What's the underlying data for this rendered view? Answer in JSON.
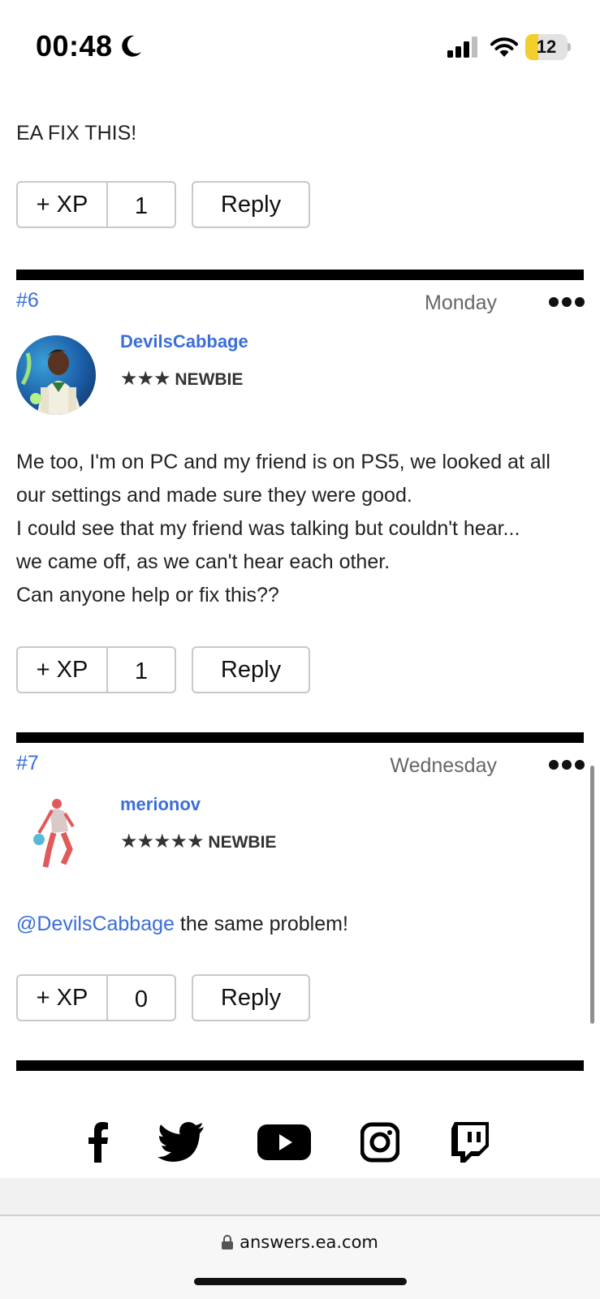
{
  "status_bar": {
    "time": "00:48",
    "battery": "12",
    "battery_level": 0.12
  },
  "posts": [
    {
      "text": "EA FIX THIS!",
      "xp_label": "+ XP",
      "xp_count": "1",
      "reply_label": "Reply"
    },
    {
      "number": "#6",
      "date": "Monday",
      "username": "DevilsCabbage",
      "stars": "★★★",
      "rank": "NEWBIE",
      "lines": [
        "Me too, I'm on PC and my friend is on PS5, we looked at all",
        "our settings and made sure they were good.",
        "I could see that my friend was talking but couldn't hear...",
        "we came off, as we can't hear each other.",
        "Can anyone help or fix this??"
      ],
      "xp_label": "+ XP",
      "xp_count": "1",
      "reply_label": "Reply"
    },
    {
      "number": "#7",
      "date": "Wednesday",
      "username": "merionov",
      "stars": "★★★★★",
      "rank": "NEWBIE",
      "mention": "@DevilsCabbage",
      "text": " the same problem!",
      "xp_label": "+ XP",
      "xp_count": "0",
      "reply_label": "Reply"
    }
  ],
  "footer": {
    "social_icons": [
      "facebook-icon",
      "twitter-icon",
      "youtube-icon",
      "instagram-icon",
      "twitch-icon"
    ]
  },
  "url_bar": {
    "url": "answers.ea.com"
  },
  "colors": {
    "link": "#3a6fd8",
    "divider": "#000000",
    "battery_fill": "#f3cf2c"
  }
}
